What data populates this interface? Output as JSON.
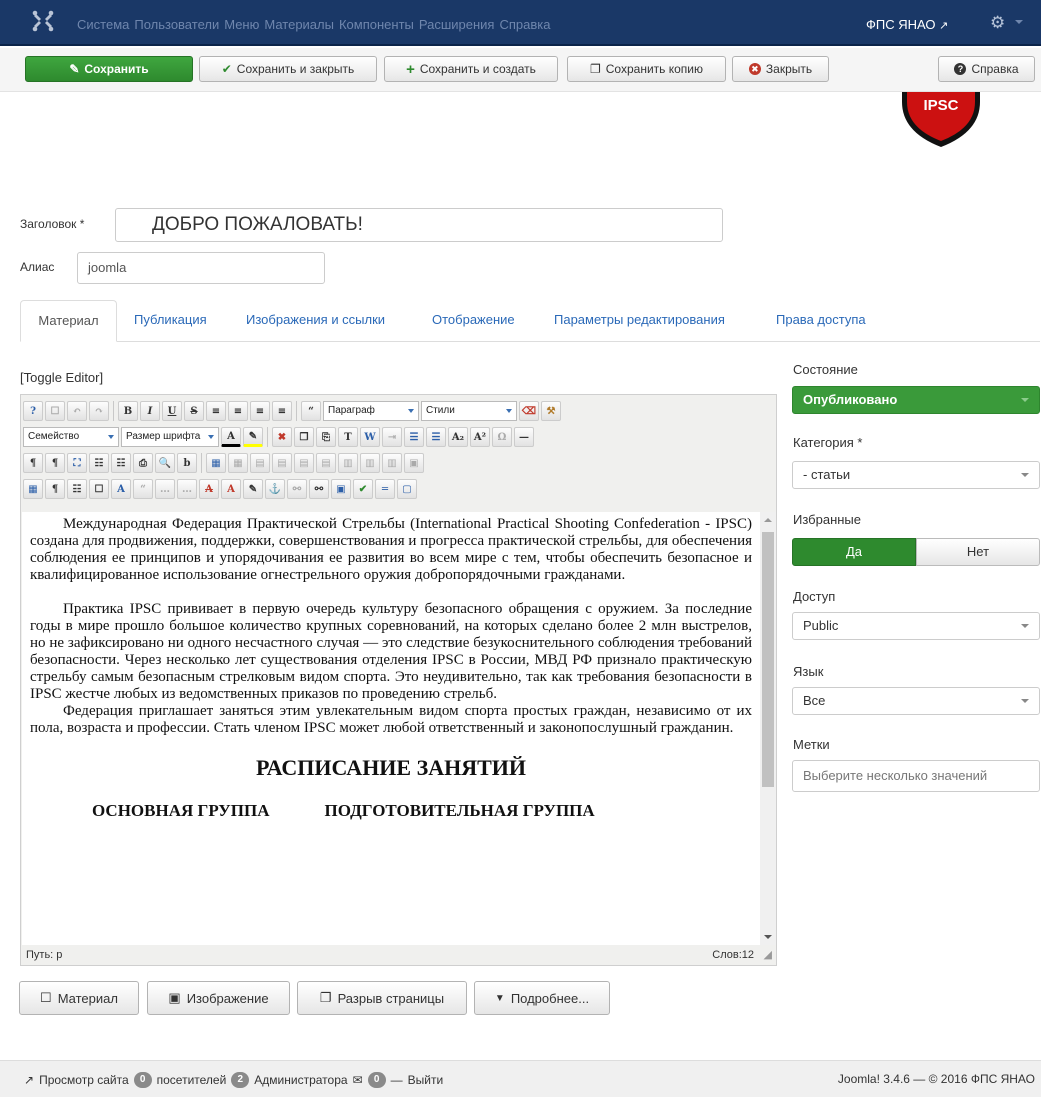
{
  "nav": {
    "menu": [
      "Система",
      "Пользователи",
      "Меню",
      "Материалы",
      "Компоненты",
      "Расширения",
      "Справка"
    ],
    "site_name": "ФПС ЯНАО"
  },
  "toolbar": {
    "save": "Сохранить",
    "save_close": "Сохранить и закрыть",
    "save_new": "Сохранить и создать",
    "save_copy": "Сохранить копию",
    "close": "Закрыть",
    "help": "Справка"
  },
  "emblem": {
    "text": "IPSC",
    "color": "#cc1111"
  },
  "form": {
    "title_label": "Заголовок *",
    "title_value": "ДОБРО ПОЖАЛОВАТЬ!",
    "alias_label": "Алиас",
    "alias_value": "joomla"
  },
  "tabs": [
    "Материал",
    "Публикация",
    "Изображения и ссылки",
    "Отображение",
    "Параметры редактирования",
    "Права доступа"
  ],
  "editor": {
    "toggle": "[Toggle Editor]",
    "format_select": "Параграф",
    "styles_select": "Стили",
    "family_select": "Семейство",
    "size_select": "Размер шрифта",
    "paragraphs": [
      "Международная Федерация Практической Стрельбы (International Practical Shooting Confederation - IPSC) создана для продвижения, поддержки, совершенствования и прогресса практической стрельбы, для обеспечения соблюдения ее принципов и упорядочивания ее развития во всем мире с тем, чтобы обеспечить безопасное и квалифицированное использование огнестрельного оружия добропорядочными гражданами.",
      "Практика IPSC прививает в первую очередь культуру безопасного обращения с оружием. За последние годы в мире прошло большое количество крупных соревнований, на которых сделано более 2 млн выстрелов, но не зафиксировано ни одного несчастного случая — это следствие безукоснительного соблюдения требований безопасности. Через несколько лет существования отделения IPSC в России, МВД РФ признало практическую стрельбу самым безопасным стрелковым видом спорта. Это неудивительно, так как требования безопасности в IPSC жестче любых из ведомственных приказов по проведению стрельб.",
      "Федерация приглашает заняться этим увлекательным видом спорта простых граждан, независимо от их пола, возраста и профессии. Стать членом IPSC может любой ответственный и законопослушный гражданин."
    ],
    "schedule_title": "РАСПИСАНИЕ ЗАНЯТИЙ",
    "group_main": "ОСНОВНАЯ ГРУППА",
    "group_prep": "ПОДГОТОВИТЕЛЬНАЯ ГРУППА",
    "path": "Путь: p",
    "words": "Слов:12"
  },
  "bottom_buttons": {
    "article": "Материал",
    "image": "Изображение",
    "pagebreak": "Разрыв страницы",
    "readmore": "Подробнее..."
  },
  "sidebar": {
    "state_label": "Состояние",
    "state_value": "Опубликовано",
    "category_label": "Категория *",
    "category_value": "- статьи",
    "featured_label": "Избранные",
    "featured_yes": "Да",
    "featured_no": "Нет",
    "access_label": "Доступ",
    "access_value": "Public",
    "language_label": "Язык",
    "language_value": "Все",
    "tags_label": "Метки",
    "tags_placeholder": "Выберите несколько значений"
  },
  "footer": {
    "view_site": "Просмотр сайта",
    "visitors_count": "0",
    "visitors_label": "посетителей",
    "admins_count": "2",
    "admins_label": "Администратора",
    "messages_count": "0",
    "logout": "Выйти",
    "copyright": "Joomla! 3.4.6 — © 2016 ФПС ЯНАО"
  },
  "colors": {
    "nav_bg": "#1a3867",
    "save_green": "#2e8a2e",
    "link_blue": "#2a69b8"
  }
}
